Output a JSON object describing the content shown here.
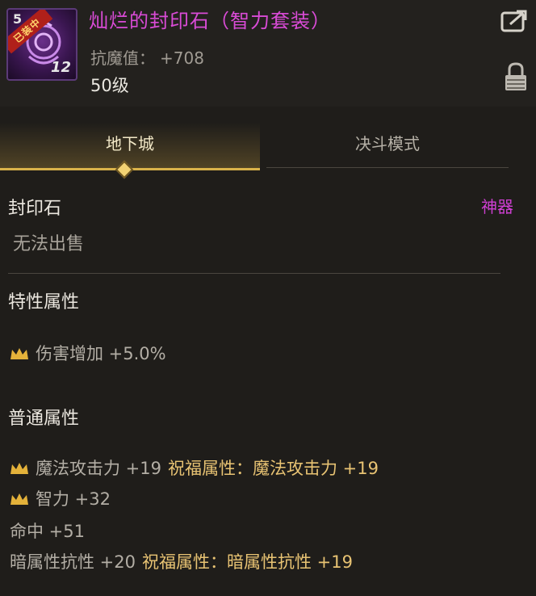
{
  "item": {
    "level_badge": "5",
    "equipped_badge": "已装中",
    "stack_count": "12",
    "name": "灿烂的封印石（智力套装）",
    "resist_label": "抗魔值：",
    "resist_value": "+708",
    "level": "50级"
  },
  "icons": {
    "share": "share-icon",
    "lock": "lock-icon",
    "crown": "crown-icon"
  },
  "tabs": [
    {
      "label": "地下城",
      "active": true
    },
    {
      "label": "决斗模式",
      "active": false
    }
  ],
  "info": {
    "type": "封印石",
    "rarity": "神器",
    "trade": "无法出售"
  },
  "special": {
    "heading": "特性属性",
    "stats": [
      {
        "text": "伤害增加 +5.0%",
        "crown": true
      }
    ]
  },
  "normal": {
    "heading": "普通属性",
    "stats": [
      {
        "text": "魔法攻击力 +19",
        "bless": "祝福属性：魔法攻击力 +19",
        "crown": true
      },
      {
        "text": "智力 +32",
        "bless": "",
        "crown": true
      },
      {
        "text": "命中 +51",
        "bless": "",
        "crown": false
      },
      {
        "text": "暗属性抗性 +20",
        "bless": "祝福属性：暗属性抗性 +19",
        "crown": false
      }
    ]
  },
  "colors": {
    "title": "#d94bd6",
    "rarity": "#cf3fd3",
    "accent_gold": "#d9b24a",
    "bless": "#e8c373"
  }
}
